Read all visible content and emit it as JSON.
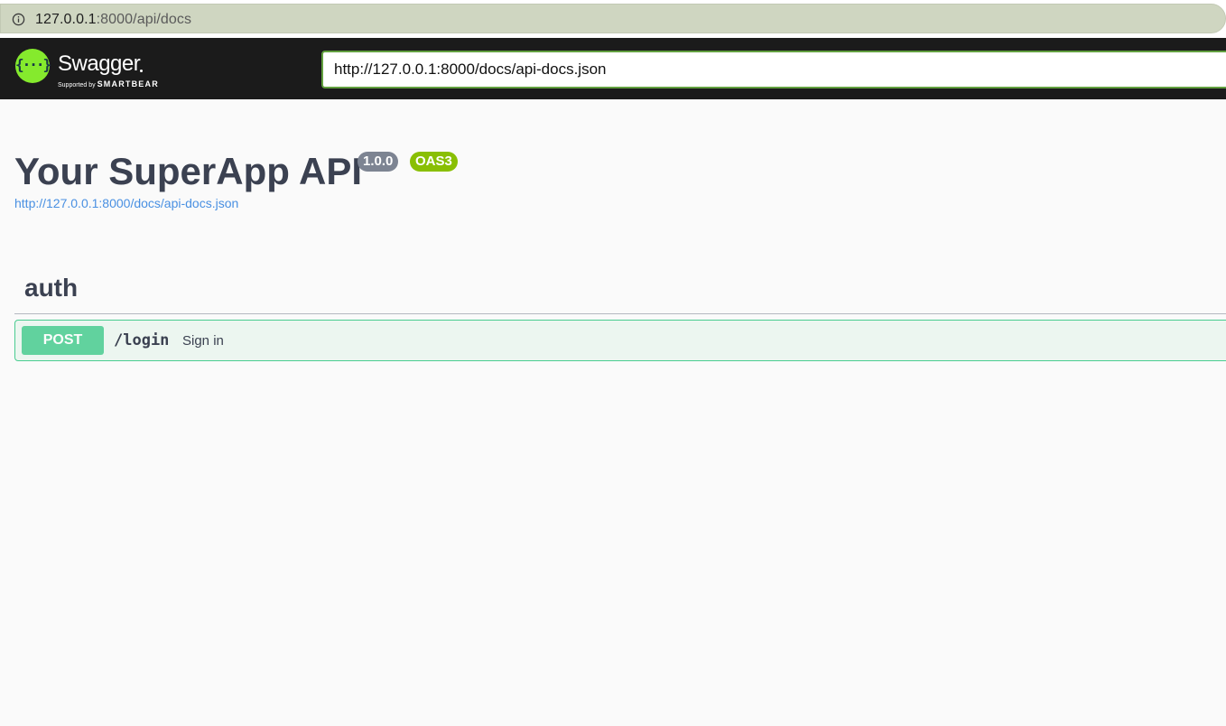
{
  "browser": {
    "url_host": "127.0.0.1",
    "url_rest": ":8000/api/docs",
    "info_icon": "info-circle-icon"
  },
  "topbar": {
    "logo_glyph": "{···}",
    "logo_word": "Swagger",
    "logo_supported_by": "Supported by",
    "logo_company": "SMARTBEAR",
    "spec_url_value": "http://127.0.0.1:8000/docs/api-docs.json",
    "brand_color": "#85ea2d"
  },
  "info": {
    "title": "Your SuperApp API",
    "version": "1.0.0",
    "oas_badge": "OAS3",
    "spec_link": "http://127.0.0.1:8000/docs/api-docs.json"
  },
  "tags": [
    {
      "name": "auth",
      "operations": [
        {
          "method": "POST",
          "path": "/login",
          "summary": "Sign in",
          "color": "#49cc90"
        }
      ]
    }
  ]
}
